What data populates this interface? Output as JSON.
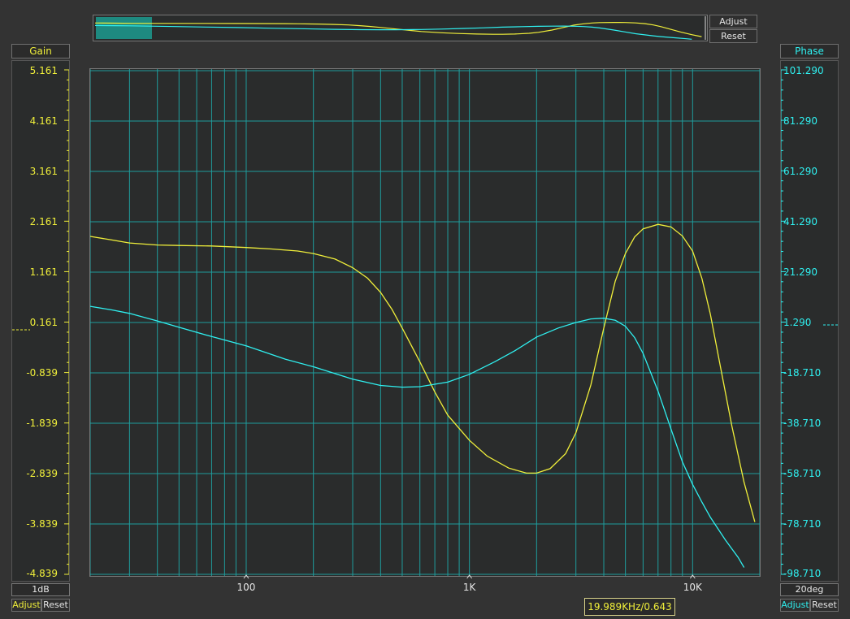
{
  "gain_panel": {
    "header": "Gain",
    "ticks": [
      "5.161",
      "4.161",
      "3.161",
      "2.161",
      "1.161",
      "0.161",
      "-0.839",
      "-1.839",
      "-2.839",
      "-3.839",
      "-4.839"
    ],
    "scale": "1dB",
    "adjust_label": "Adjust",
    "reset_label": "Reset"
  },
  "phase_panel": {
    "header": "Phase",
    "ticks": [
      "101.290",
      "81.290",
      "61.290",
      "41.290",
      "21.290",
      "1.290",
      "-18.710",
      "-38.710",
      "-58.710",
      "-78.710",
      "-98.710"
    ],
    "scale": "20deg",
    "adjust_label": "Adjust",
    "reset_label": "Reset"
  },
  "overview": {
    "adjust_label": "Adjust",
    "reset_label": "Reset"
  },
  "readout": "19.989KHz/0.643",
  "colors": {
    "gain": "#f0ef3a",
    "phase": "#2ff0f0",
    "grid": "#1f9d9d",
    "background": "#2a2c2c"
  },
  "chart_data": {
    "type": "line",
    "x_scale": "log",
    "x_range": [
      20,
      20000
    ],
    "x_tick_labels": [
      {
        "value": 100,
        "label": "100"
      },
      {
        "value": 1000,
        "label": "1K"
      },
      {
        "value": 10000,
        "label": "10K"
      }
    ],
    "y_left": {
      "label": "Gain",
      "unit": "dB",
      "range": [
        -4.839,
        5.161
      ],
      "step": 1
    },
    "y_right": {
      "label": "Phase",
      "unit": "deg",
      "range": [
        -98.71,
        101.29
      ],
      "step": 20
    },
    "grid": true,
    "series": [
      {
        "key": "gain",
        "axis": "left",
        "points": [
          [
            20,
            1.87
          ],
          [
            25,
            1.8
          ],
          [
            30,
            1.74
          ],
          [
            40,
            1.7
          ],
          [
            50,
            1.69
          ],
          [
            70,
            1.68
          ],
          [
            100,
            1.65
          ],
          [
            130,
            1.62
          ],
          [
            170,
            1.58
          ],
          [
            200,
            1.53
          ],
          [
            250,
            1.42
          ],
          [
            300,
            1.25
          ],
          [
            350,
            1.04
          ],
          [
            400,
            0.76
          ],
          [
            450,
            0.42
          ],
          [
            500,
            0.05
          ],
          [
            600,
            -0.62
          ],
          [
            700,
            -1.22
          ],
          [
            800,
            -1.68
          ],
          [
            1000,
            -2.18
          ],
          [
            1200,
            -2.49
          ],
          [
            1500,
            -2.73
          ],
          [
            1800,
            -2.83
          ],
          [
            2000,
            -2.83
          ],
          [
            2300,
            -2.74
          ],
          [
            2700,
            -2.44
          ],
          [
            3000,
            -2.03
          ],
          [
            3500,
            -1.08
          ],
          [
            4000,
            0.05
          ],
          [
            4500,
            0.98
          ],
          [
            5000,
            1.53
          ],
          [
            5500,
            1.86
          ],
          [
            6000,
            2.02
          ],
          [
            7000,
            2.11
          ],
          [
            8000,
            2.06
          ],
          [
            9000,
            1.88
          ],
          [
            10000,
            1.58
          ],
          [
            11000,
            1.04
          ],
          [
            12000,
            0.33
          ],
          [
            13000,
            -0.47
          ],
          [
            15000,
            -1.9
          ],
          [
            17000,
            -3.01
          ],
          [
            19000,
            -3.8
          ]
        ]
      },
      {
        "key": "phase",
        "axis": "right",
        "points": [
          [
            20,
            7.7
          ],
          [
            25,
            6.3
          ],
          [
            30,
            4.9
          ],
          [
            40,
            1.9
          ],
          [
            50,
            -0.6
          ],
          [
            70,
            -4.3
          ],
          [
            100,
            -8.0
          ],
          [
            150,
            -13.3
          ],
          [
            200,
            -16.3
          ],
          [
            300,
            -21.2
          ],
          [
            400,
            -23.7
          ],
          [
            500,
            -24.4
          ],
          [
            600,
            -24.2
          ],
          [
            800,
            -22.4
          ],
          [
            1000,
            -19.3
          ],
          [
            1300,
            -14.3
          ],
          [
            1600,
            -9.9
          ],
          [
            2000,
            -4.5
          ],
          [
            2500,
            -0.9
          ],
          [
            3000,
            1.3
          ],
          [
            3500,
            2.7
          ],
          [
            4000,
            3.0
          ],
          [
            4500,
            2.2
          ],
          [
            5000,
            -0.2
          ],
          [
            5500,
            -4.7
          ],
          [
            6000,
            -11.0
          ],
          [
            7000,
            -26.0
          ],
          [
            8000,
            -41.0
          ],
          [
            9000,
            -54.0
          ],
          [
            10000,
            -63.0
          ],
          [
            11000,
            -70.0
          ],
          [
            12000,
            -76.0
          ],
          [
            14000,
            -85.0
          ],
          [
            16000,
            -92.0
          ],
          [
            17000,
            -96.0
          ]
        ]
      }
    ]
  }
}
